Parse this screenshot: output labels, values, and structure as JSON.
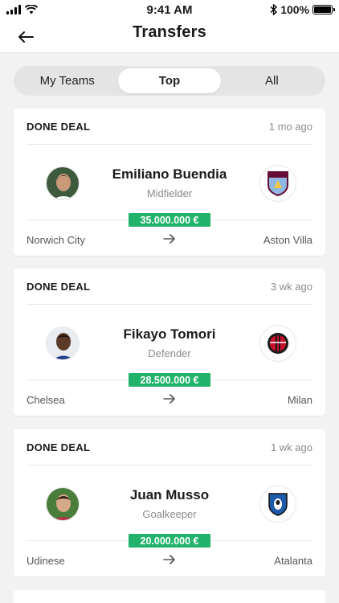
{
  "status_bar": {
    "time": "9:41 AM",
    "battery": "100%"
  },
  "header": {
    "title": "Transfers"
  },
  "tabs": [
    {
      "label": "My Teams",
      "active": false
    },
    {
      "label": "Top",
      "active": true
    },
    {
      "label": "All",
      "active": false
    }
  ],
  "transfers": [
    {
      "status": "DONE DEAL",
      "time_ago": "1 mo ago",
      "player": "Emiliano Buendia",
      "position": "Midfielder",
      "fee": "35.000.000 €",
      "from": "Norwich City",
      "to": "Aston Villa",
      "crest_icon": "aston-villa-crest-icon"
    },
    {
      "status": "DONE DEAL",
      "time_ago": "3 wk ago",
      "player": "Fikayo Tomori",
      "position": "Defender",
      "fee": "28.500.000 €",
      "from": "Chelsea",
      "to": "Milan",
      "crest_icon": "ac-milan-crest-icon"
    },
    {
      "status": "DONE DEAL",
      "time_ago": "1 wk ago",
      "player": "Juan Musso",
      "position": "Goalkeeper",
      "fee": "20.000.000 €",
      "from": "Udinese",
      "to": "Atalanta",
      "crest_icon": "atalanta-crest-icon"
    }
  ],
  "colors": {
    "fee_badge": "#21b36b",
    "accent": "#1a1a1a"
  }
}
